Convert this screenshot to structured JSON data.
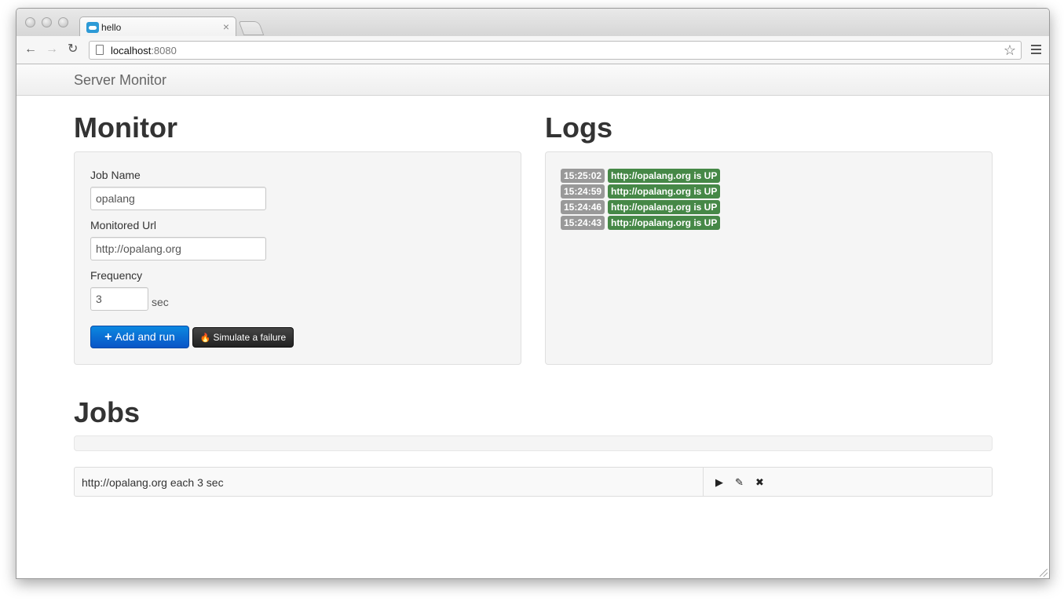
{
  "browser": {
    "tab_title": "hello",
    "tab_close": "×",
    "url_host": "localhost",
    "url_port": ":8080",
    "back_icon": "←",
    "forward_icon": "→",
    "reload_icon": "↻",
    "star_icon": "☆"
  },
  "navbar": {
    "brand": "Server Monitor"
  },
  "monitor": {
    "heading": "Monitor",
    "job_name_label": "Job Name",
    "job_name_value": "opalang",
    "url_label": "Monitored Url",
    "url_value": "http://opalang.org",
    "frequency_label": "Frequency",
    "frequency_value": "3",
    "frequency_unit": "sec",
    "add_button": "Add and run",
    "add_icon": "+",
    "simulate_button": "Simulate a failure",
    "fire_icon": "🔥"
  },
  "logs": {
    "heading": "Logs",
    "entries": [
      {
        "time": "15:25:02",
        "message": "http://opalang.org is UP"
      },
      {
        "time": "15:24:59",
        "message": "http://opalang.org is UP"
      },
      {
        "time": "15:24:46",
        "message": "http://opalang.org is UP"
      },
      {
        "time": "15:24:43",
        "message": "http://opalang.org is UP"
      }
    ]
  },
  "jobs": {
    "heading": "Jobs",
    "rows": [
      {
        "description": "http://opalang.org each 3 sec",
        "play_icon": "▶",
        "edit_icon": "✎",
        "delete_icon": "✖"
      }
    ]
  },
  "colors": {
    "primary": "#0a63d1",
    "success": "#468847",
    "time_badge": "#999999",
    "inverse": "#222222"
  }
}
